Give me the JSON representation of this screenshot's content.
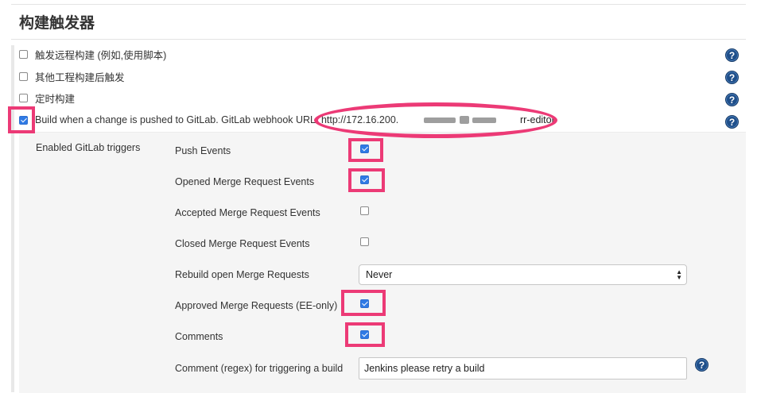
{
  "section": {
    "title": "构建触发器"
  },
  "options": [
    {
      "label": "触发远程构建 (例如,使用脚本)",
      "checked": false
    },
    {
      "label": "其他工程构建后触发",
      "checked": false
    },
    {
      "label": "定时构建",
      "checked": false
    },
    {
      "label": "Build when a change is pushed to GitLab. GitLab webhook URL: http://172.16.200.",
      "checked": true
    }
  ],
  "webhook": {
    "url_suffix": "rr-editor"
  },
  "gitlab": {
    "section_label": "Enabled GitLab triggers",
    "triggers": [
      {
        "label": "Push Events",
        "checked": true
      },
      {
        "label": "Opened Merge Request Events",
        "checked": true
      },
      {
        "label": "Accepted Merge Request Events",
        "checked": false
      },
      {
        "label": "Closed Merge Request Events",
        "checked": false
      },
      {
        "label": "Rebuild open Merge Requests"
      },
      {
        "label": "Approved Merge Requests (EE-only)",
        "checked": true
      },
      {
        "label": "Comments",
        "checked": true
      },
      {
        "label": "Comment (regex) for triggering a build"
      }
    ],
    "rebuild_select": {
      "value": "Never"
    },
    "comment_regex": {
      "value": "Jenkins please retry a build"
    }
  },
  "help_icon_glyph": "?",
  "colors": {
    "highlight": "#ec3a76",
    "checkbox_checked": "#2f7ae5",
    "help_icon": "#1f4f8a"
  }
}
